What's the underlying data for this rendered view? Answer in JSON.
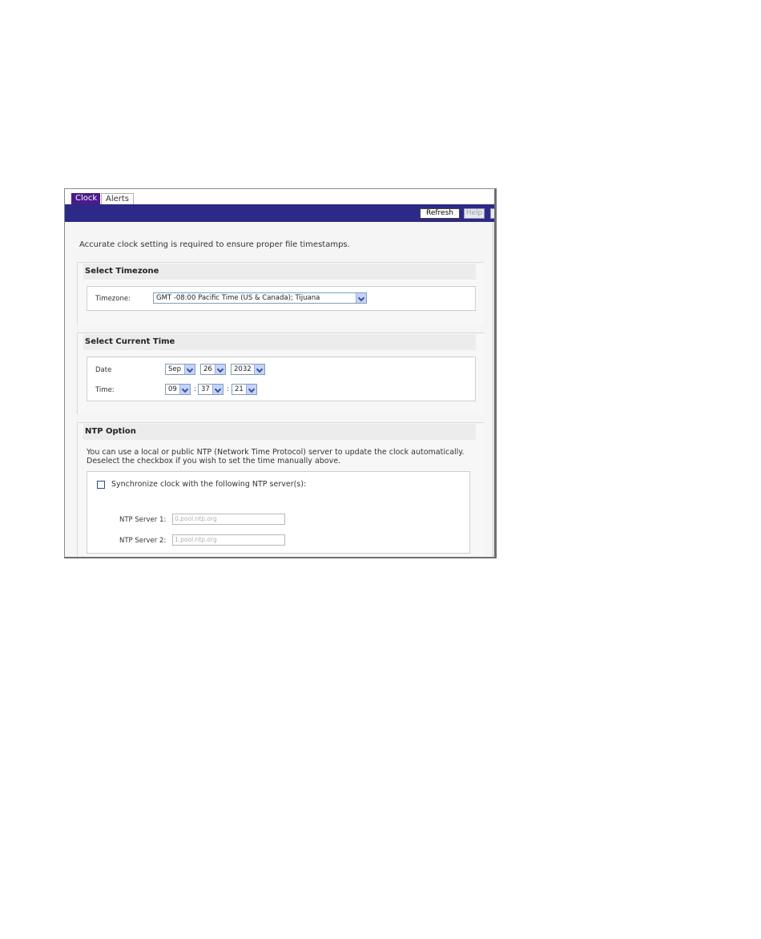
{
  "tabs": [
    {
      "label": "Clock"
    },
    {
      "label": "Alerts"
    }
  ],
  "toolbar": {
    "refresh_label": "Refresh",
    "help_label": "Help"
  },
  "intro_text": "Accurate clock setting is required to ensure proper file timestamps.",
  "timezone_section": {
    "title": "Select Timezone",
    "label": "Timezone:",
    "selected": "GMT -08:00 Pacific Time (US & Canada); Tijuana"
  },
  "time_section": {
    "title": "Select Current Time",
    "date_label": "Date",
    "time_label": "Time:",
    "month": "Sep",
    "day": "26",
    "year": "2032",
    "hour": "09",
    "minute": "37",
    "second": "21",
    "separator": ":"
  },
  "ntp_section": {
    "title": "NTP Option",
    "description_line1": "You can use a local or public NTP (Network Time Protocol) server to update the clock automatically.",
    "description_line2": "Deselect the checkbox if you wish to set the time manually above.",
    "sync_label": "Synchronize clock with the following NTP server(s):",
    "sync_checked": false,
    "server1_label": "NTP Server 1:",
    "server1_value": "0.pool.ntp.org",
    "server2_label": "NTP Server 2:",
    "server2_value": "1.pool.ntp.org"
  },
  "colors": {
    "tab_active": "#4b1a8c",
    "header_bar": "#2c2a88",
    "dropdown_arrow": "#c3d3fd"
  }
}
